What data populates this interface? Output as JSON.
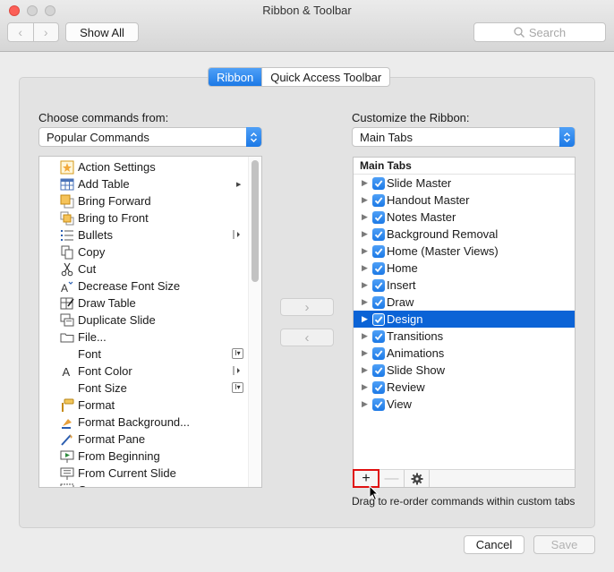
{
  "window": {
    "title": "Ribbon & Toolbar",
    "back_glyph": "‹",
    "forward_glyph": "›",
    "show_all_label": "Show All",
    "search_placeholder": "Search"
  },
  "tabs": [
    {
      "label": "Ribbon",
      "active": true
    },
    {
      "label": "Quick Access Toolbar",
      "active": false
    }
  ],
  "left": {
    "label": "Choose commands from:",
    "select_value": "Popular Commands",
    "commands": [
      {
        "label": "Action Settings",
        "icon": "action-settings-icon",
        "sub": ""
      },
      {
        "label": "Add Table",
        "icon": "table-icon",
        "sub": "submenu"
      },
      {
        "label": "Bring Forward",
        "icon": "bring-forward-icon",
        "sub": ""
      },
      {
        "label": "Bring to Front",
        "icon": "bring-to-front-icon",
        "sub": ""
      },
      {
        "label": "Bullets",
        "icon": "bullets-icon",
        "sub": "split"
      },
      {
        "label": "Copy",
        "icon": "copy-icon",
        "sub": ""
      },
      {
        "label": "Cut",
        "icon": "scissors-icon",
        "sub": ""
      },
      {
        "label": "Decrease Font Size",
        "icon": "decrease-font-icon",
        "sub": ""
      },
      {
        "label": "Draw Table",
        "icon": "draw-table-icon",
        "sub": ""
      },
      {
        "label": "Duplicate Slide",
        "icon": "duplicate-slide-icon",
        "sub": ""
      },
      {
        "label": "File...",
        "icon": "folder-icon",
        "sub": ""
      },
      {
        "label": "Font",
        "icon": "",
        "sub": "combo"
      },
      {
        "label": "Font Color",
        "icon": "font-color-icon",
        "sub": "split"
      },
      {
        "label": "Font Size",
        "icon": "",
        "sub": "combo"
      },
      {
        "label": "Format",
        "icon": "format-painter-icon",
        "sub": ""
      },
      {
        "label": "Format Background...",
        "icon": "format-background-icon",
        "sub": ""
      },
      {
        "label": "Format Pane",
        "icon": "format-pane-icon",
        "sub": ""
      },
      {
        "label": "From Beginning",
        "icon": "from-beginning-icon",
        "sub": ""
      },
      {
        "label": "From Current Slide",
        "icon": "from-current-slide-icon",
        "sub": ""
      },
      {
        "label": "G...",
        "icon": "group-icon",
        "sub": ""
      }
    ]
  },
  "middle": {
    "add_glyph": "›",
    "remove_glyph": "‹"
  },
  "right": {
    "label": "Customize the Ribbon:",
    "select_value": "Main Tabs",
    "tree_header": "Main Tabs",
    "tabs": [
      {
        "label": "Slide Master",
        "checked": true,
        "selected": false
      },
      {
        "label": "Handout Master",
        "checked": true,
        "selected": false
      },
      {
        "label": "Notes Master",
        "checked": true,
        "selected": false
      },
      {
        "label": "Background Removal",
        "checked": true,
        "selected": false
      },
      {
        "label": "Home (Master Views)",
        "checked": true,
        "selected": false
      },
      {
        "label": "Home",
        "checked": true,
        "selected": false
      },
      {
        "label": "Insert",
        "checked": true,
        "selected": false
      },
      {
        "label": "Draw",
        "checked": true,
        "selected": false
      },
      {
        "label": "Design",
        "checked": true,
        "selected": true
      },
      {
        "label": "Transitions",
        "checked": true,
        "selected": false
      },
      {
        "label": "Animations",
        "checked": true,
        "selected": false
      },
      {
        "label": "Slide Show",
        "checked": true,
        "selected": false
      },
      {
        "label": "Review",
        "checked": true,
        "selected": false
      },
      {
        "label": "View",
        "checked": true,
        "selected": false
      }
    ],
    "toolbar": {
      "add_glyph": "+",
      "remove_glyph": "—",
      "settings_icon": "gear-icon"
    },
    "hint": "Drag to re-order commands within custom tabs"
  },
  "footer": {
    "cancel_label": "Cancel",
    "save_label": "Save"
  },
  "colors": {
    "accent": "#1c79e6",
    "selection": "#0b63d6",
    "highlight_border": "#e01010"
  }
}
